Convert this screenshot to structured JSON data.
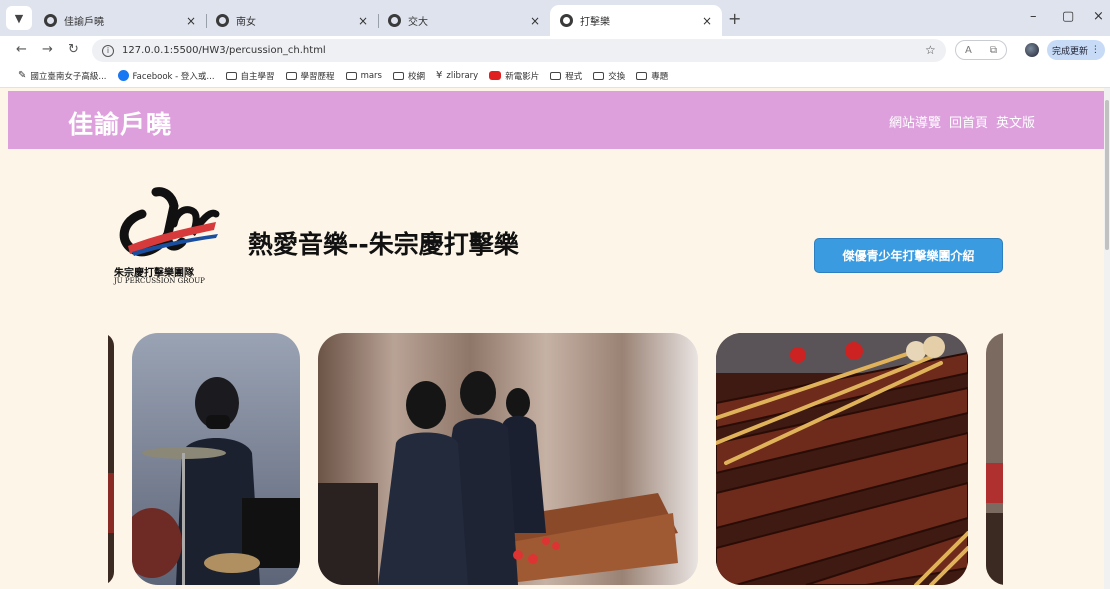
{
  "browser": {
    "tabs": [
      {
        "title": "佳諭戶曉"
      },
      {
        "title": "南女"
      },
      {
        "title": "交大"
      },
      {
        "title": "打擊樂"
      }
    ],
    "address": "127.0.0.1:5500/HW3/percussion_ch.html",
    "update_label": "完成更新",
    "bookmarks": [
      {
        "label": "國立臺南女子高級...",
        "icon": "school-icon"
      },
      {
        "label": "Facebook - 登入或...",
        "icon": "facebook-icon"
      },
      {
        "label": "自主學習",
        "icon": "folder-icon"
      },
      {
        "label": "學習歷程",
        "icon": "folder-icon"
      },
      {
        "label": "mars",
        "icon": "folder-icon"
      },
      {
        "label": "校網",
        "icon": "folder-icon"
      },
      {
        "label": "zlibrary",
        "icon": "zlibrary-icon"
      },
      {
        "label": "新電影片",
        "icon": "youtube-icon"
      },
      {
        "label": "程式",
        "icon": "folder-icon"
      },
      {
        "label": "交換",
        "icon": "folder-icon"
      },
      {
        "label": "專題",
        "icon": "folder-icon"
      }
    ]
  },
  "site": {
    "title": "佳諭戶曉",
    "nav": [
      "網站導覽",
      "回首頁",
      "英文版"
    ]
  },
  "main": {
    "logo_text_zh": "朱宗慶打擊樂團隊",
    "logo_text_en": "JU PERCUSSION GROUP",
    "heading": "熱愛音樂--朱宗慶打擊樂",
    "cta_label": "傑優青少年打擊樂團介紹"
  },
  "colors": {
    "header_bg": "#dda0dd",
    "page_bg": "#fdf6e8",
    "cta_bg": "#3b9be0"
  }
}
